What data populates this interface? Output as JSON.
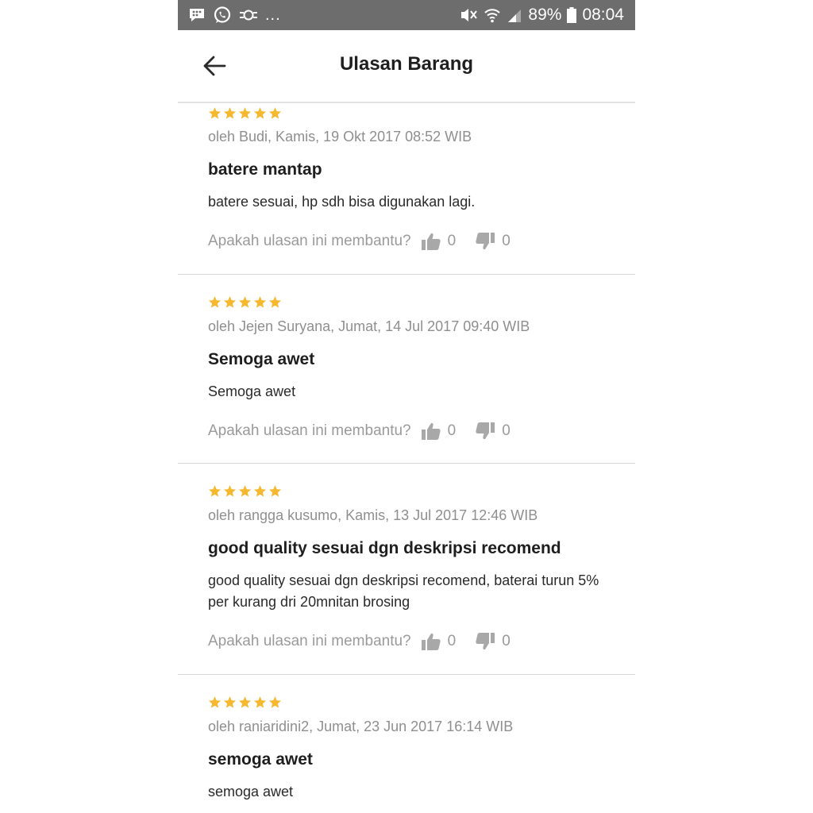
{
  "status_bar": {
    "battery": "89%",
    "time": "08:04",
    "more": "...",
    "icons_left": [
      "bbm-icon",
      "whatsapp-icon",
      "sync-icon"
    ],
    "icons_right": [
      "mute-icon",
      "wifi-icon",
      "signal-icon",
      "battery-icon"
    ]
  },
  "app_bar": {
    "title": "Ulasan Barang",
    "back_icon": "arrow-left-icon"
  },
  "colors": {
    "status_bar_bg": "#6d6d6d",
    "star": "#f5b82e",
    "muted_text": "#8f8f8f",
    "divider": "#d6d6d6"
  },
  "helpful_label": "Apakah ulasan ini membantu?",
  "reviews": [
    {
      "rating": 5,
      "meta": "oleh Budi, Kamis, 19 Okt 2017 08:52 WIB",
      "title": "batere mantap",
      "body": "batere sesuai, hp sdh bisa digunakan lagi.",
      "likes": "0",
      "dislikes": "0"
    },
    {
      "rating": 5,
      "meta": "oleh Jejen Suryana, Jumat, 14 Jul 2017 09:40 WIB",
      "title": "Semoga awet",
      "body": "Semoga awet",
      "likes": "0",
      "dislikes": "0"
    },
    {
      "rating": 5,
      "meta": "oleh rangga kusumo, Kamis, 13 Jul 2017 12:46 WIB",
      "title": "good quality sesuai dgn deskripsi recomend",
      "body": "good quality sesuai dgn deskripsi recomend, baterai turun 5% per kurang dri 20mnitan brosing",
      "likes": "0",
      "dislikes": "0"
    },
    {
      "rating": 5,
      "meta": "oleh raniaridini2, Jumat, 23 Jun 2017 16:14 WIB",
      "title": "semoga awet",
      "body": "semoga awet"
    }
  ]
}
